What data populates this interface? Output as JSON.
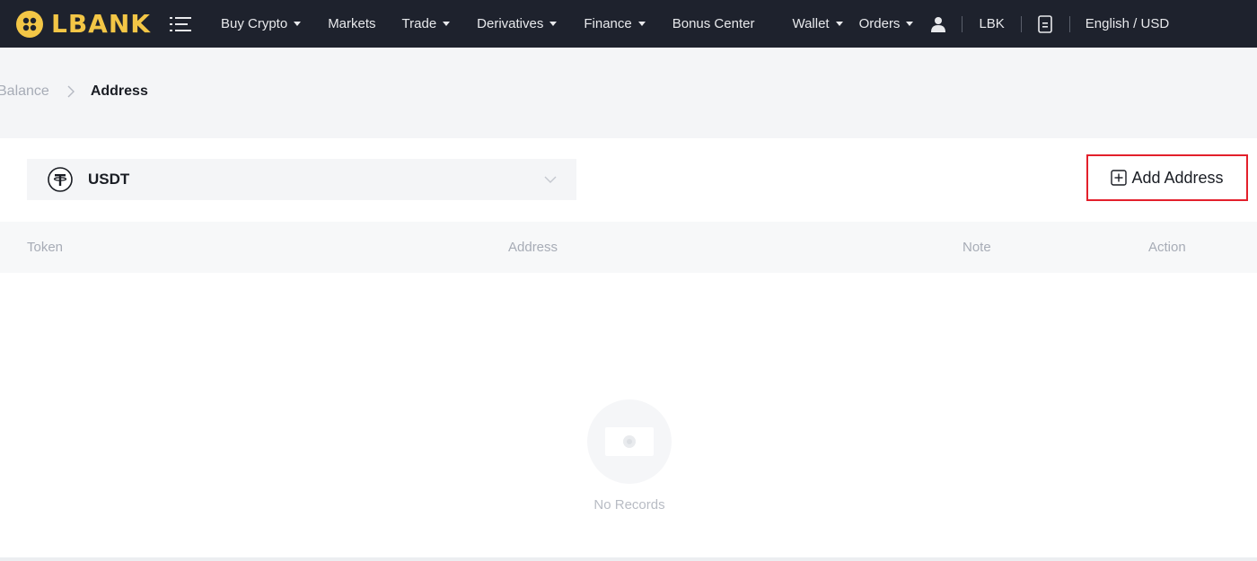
{
  "brand": {
    "name": "LBANK",
    "color": "#f3c646"
  },
  "nav": {
    "items": [
      {
        "label": "Buy Crypto",
        "dropdown": true
      },
      {
        "label": "Markets",
        "dropdown": false
      },
      {
        "label": "Trade",
        "dropdown": true
      },
      {
        "label": "Derivatives",
        "dropdown": true
      },
      {
        "label": "Finance",
        "dropdown": true
      },
      {
        "label": "Bonus Center",
        "dropdown": false
      }
    ],
    "right": {
      "wallet": "Wallet",
      "orders": "Orders",
      "lbk": "LBK",
      "language": "English / USD"
    }
  },
  "breadcrumb": {
    "previous": "Balance",
    "current": "Address"
  },
  "token_select": {
    "value": "USDT",
    "icon": "tether-icon"
  },
  "add_address": {
    "label": "Add Address",
    "highlight_color": "#e3202b"
  },
  "table": {
    "columns": [
      "Token",
      "Address",
      "Note",
      "Action"
    ],
    "rows": []
  },
  "empty_state": {
    "label": "No Records"
  }
}
